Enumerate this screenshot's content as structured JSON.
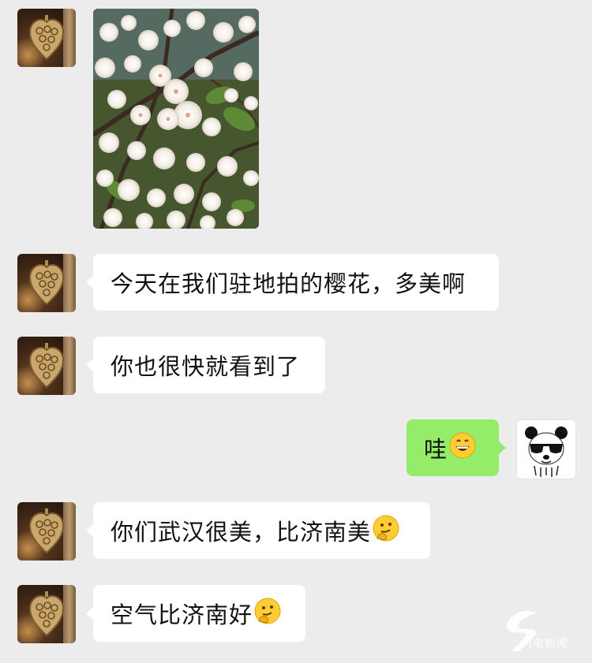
{
  "messages": [
    {
      "id": "m1",
      "side": "in",
      "type": "image",
      "image_alt": "cherry blossom photo"
    },
    {
      "id": "m2",
      "side": "in",
      "type": "text",
      "text": "今天在我们驻地拍的樱花，多美啊"
    },
    {
      "id": "m3",
      "side": "in",
      "type": "text",
      "text": "你也很快就看到了"
    },
    {
      "id": "m4",
      "side": "out",
      "type": "text",
      "text": "哇",
      "emoji": "grinning-face-emoji"
    },
    {
      "id": "m5",
      "side": "in",
      "type": "text",
      "text": "你们武汉很美，比济南美",
      "emoji": "thinking-face-emoji"
    },
    {
      "id": "m6",
      "side": "in",
      "type": "text",
      "text": "空气比济南好",
      "emoji": "thinking-face-emoji"
    }
  ],
  "avatars": {
    "contact": "heart-pendant-avatar",
    "self": "panda-sunglasses-avatar"
  },
  "watermark": {
    "text": "闪电新闻",
    "icon": "lightning-s-logo"
  },
  "colors": {
    "background": "#ececec",
    "bubble_in": "#ffffff",
    "bubble_out": "#95ec69",
    "text": "#111111"
  }
}
